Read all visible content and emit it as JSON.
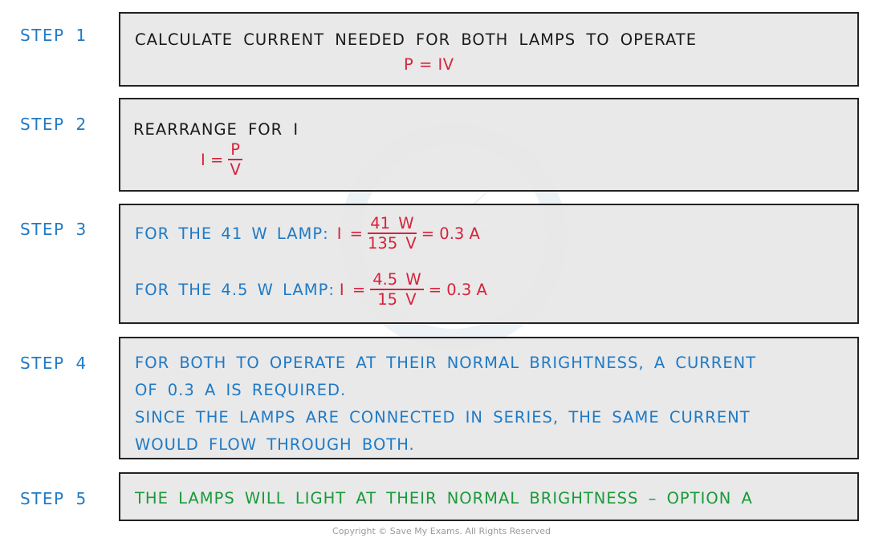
{
  "colors": {
    "step_label": "#1f7ac6",
    "instruction_text": "#1b1b1b",
    "equation": "#d6233b",
    "explanation": "#1f7ac6",
    "conclusion": "#1a9a3a",
    "box_fill": "#e7e7e7",
    "box_border": "#222222"
  },
  "steps": [
    {
      "label": "STEP  1",
      "text": "CALCULATE  CURRENT  NEEDED  FOR  BOTH  LAMPS  TO  OPERATE",
      "equation": "P = IV"
    },
    {
      "label": "STEP  2",
      "text": "REARRANGE  FOR  I",
      "equation": {
        "lhs": "I =",
        "numerator": "P",
        "denominator": "V"
      }
    },
    {
      "label": "STEP  3",
      "lines": [
        {
          "prefix": "FOR  THE  41 W  LAMP:",
          "lhs": "I =",
          "numerator": "41 W",
          "denominator": "135 V",
          "result": "= 0.3 A"
        },
        {
          "prefix": "FOR  THE  4.5 W  LAMP:",
          "lhs": "I =",
          "numerator": "4.5 W",
          "denominator": "15 V",
          "result": "= 0.3 A"
        }
      ]
    },
    {
      "label": "STEP  4",
      "lines": [
        "FOR  BOTH  TO  OPERATE  AT  THEIR  NORMAL  BRIGHTNESS,  A  CURRENT",
        "OF  0.3 A  IS  REQUIRED.",
        "SINCE  THE  LAMPS  ARE  CONNECTED  IN  SERIES,  THE  SAME  CURRENT",
        "WOULD  FLOW  THROUGH  BOTH."
      ]
    },
    {
      "label": "STEP  5",
      "text": "THE  LAMPS  WILL  LIGHT  AT  THEIR  NORMAL  BRIGHTNESS – OPTION  A"
    }
  ],
  "footer": {
    "copyright": "Copyright © Save My Exams. All Rights Reserved"
  }
}
